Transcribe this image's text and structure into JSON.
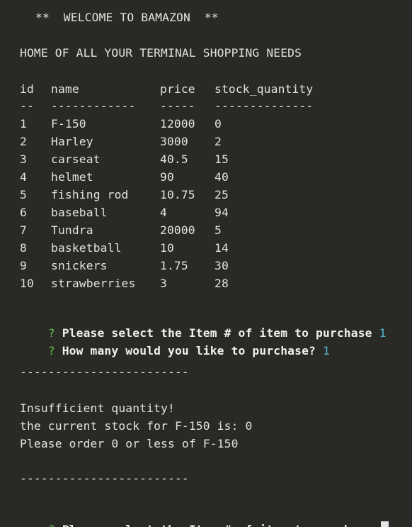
{
  "welcome": "**  WELCOME TO BAMAZON  **",
  "tagline": "HOME OF ALL YOUR TERMINAL SHOPPING NEEDS",
  "table": {
    "headers": [
      "id",
      "name",
      "price",
      "stock_quantity"
    ],
    "separators": [
      "--",
      "------------",
      "-----",
      "--------------"
    ],
    "rows": [
      [
        "1",
        "F-150",
        "12000",
        "0"
      ],
      [
        "2",
        "Harley",
        "3000",
        "2"
      ],
      [
        "3",
        "carseat",
        "40.5",
        "15"
      ],
      [
        "4",
        "helmet",
        "90",
        "40"
      ],
      [
        "5",
        "fishing rod",
        "10.75",
        "25"
      ],
      [
        "6",
        "baseball",
        "4",
        "94"
      ],
      [
        "7",
        "Tundra",
        "20000",
        "5"
      ],
      [
        "8",
        "basketball",
        "10",
        "14"
      ],
      [
        "9",
        "snickers",
        "1.75",
        "30"
      ],
      [
        "10",
        "strawberries",
        "3",
        "28"
      ]
    ]
  },
  "prompts": {
    "mark": "?",
    "select_item": "Please select the Item # of item to purchase",
    "select_item_answer": "1",
    "how_many": "How many would you like to purchase?",
    "how_many_answer": "1"
  },
  "divider": "------------------------",
  "messages": {
    "insufficient": "Insufficient quantity!",
    "current_stock": "the current stock for F-150 is: 0",
    "order_limit": "Please order 0 or less of F-150"
  },
  "colors": {
    "background": "#292a26",
    "text": "#e2e2e2",
    "prompt_mark": "#67c04a",
    "answer": "#4fb6c9"
  }
}
